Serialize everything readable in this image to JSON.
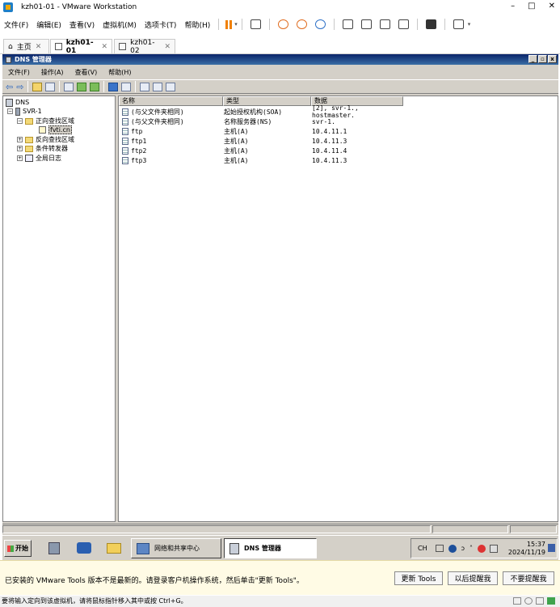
{
  "window": {
    "title": "kzh01-01 - VMware Workstation"
  },
  "vm_menu": [
    "文件(F)",
    "编辑(E)",
    "查看(V)",
    "虚拟机(M)",
    "选项卡(T)",
    "帮助(H)"
  ],
  "tabs": [
    {
      "label": "主页"
    },
    {
      "label": "kzh01-01"
    },
    {
      "label": "kzh01-02"
    }
  ],
  "dns": {
    "title": "DNS 管理器",
    "menu": [
      "文件(F)",
      "操作(A)",
      "查看(V)",
      "帮助(H)"
    ],
    "tree": {
      "root": "DNS",
      "server": "SVR-1",
      "forward_zone": "正向查找区域",
      "zone": "fvti.cn",
      "reverse_zone": "反向查找区域",
      "forwarders": "条件转发器",
      "logs": "全局日志"
    },
    "columns": [
      "名称",
      "类型",
      "数据"
    ],
    "records": [
      {
        "name": "(与父文件夹相同)",
        "type": "起始授权机构(SOA)",
        "data": "[2], svr-1., hostmaster."
      },
      {
        "name": "(与父文件夹相同)",
        "type": "名称服务器(NS)",
        "data": "svr-1."
      },
      {
        "name": "ftp",
        "type": "主机(A)",
        "data": "10.4.11.1"
      },
      {
        "name": "ftp1",
        "type": "主机(A)",
        "data": "10.4.11.3"
      },
      {
        "name": "ftp2",
        "type": "主机(A)",
        "data": "10.4.11.4"
      },
      {
        "name": "ftp3",
        "type": "主机(A)",
        "data": "10.4.11.3"
      }
    ]
  },
  "taskbar": {
    "start": "开始",
    "task1": "网络和共享中心",
    "task2": "DNS 管理器",
    "lang": "CH",
    "time": "15:37",
    "date": "2024/11/19"
  },
  "notice": {
    "message": "已安装的 VMware Tools 版本不是最新的。请登录客户机操作系统，然后单击\"更新 Tools\"。",
    "update": "更新 Tools",
    "later": "以后提醒我",
    "never": "不要提醒我"
  },
  "status": {
    "text": "要将输入定向到该虚拟机，请将鼠标指针移入其中或按 Ctrl+G。"
  }
}
